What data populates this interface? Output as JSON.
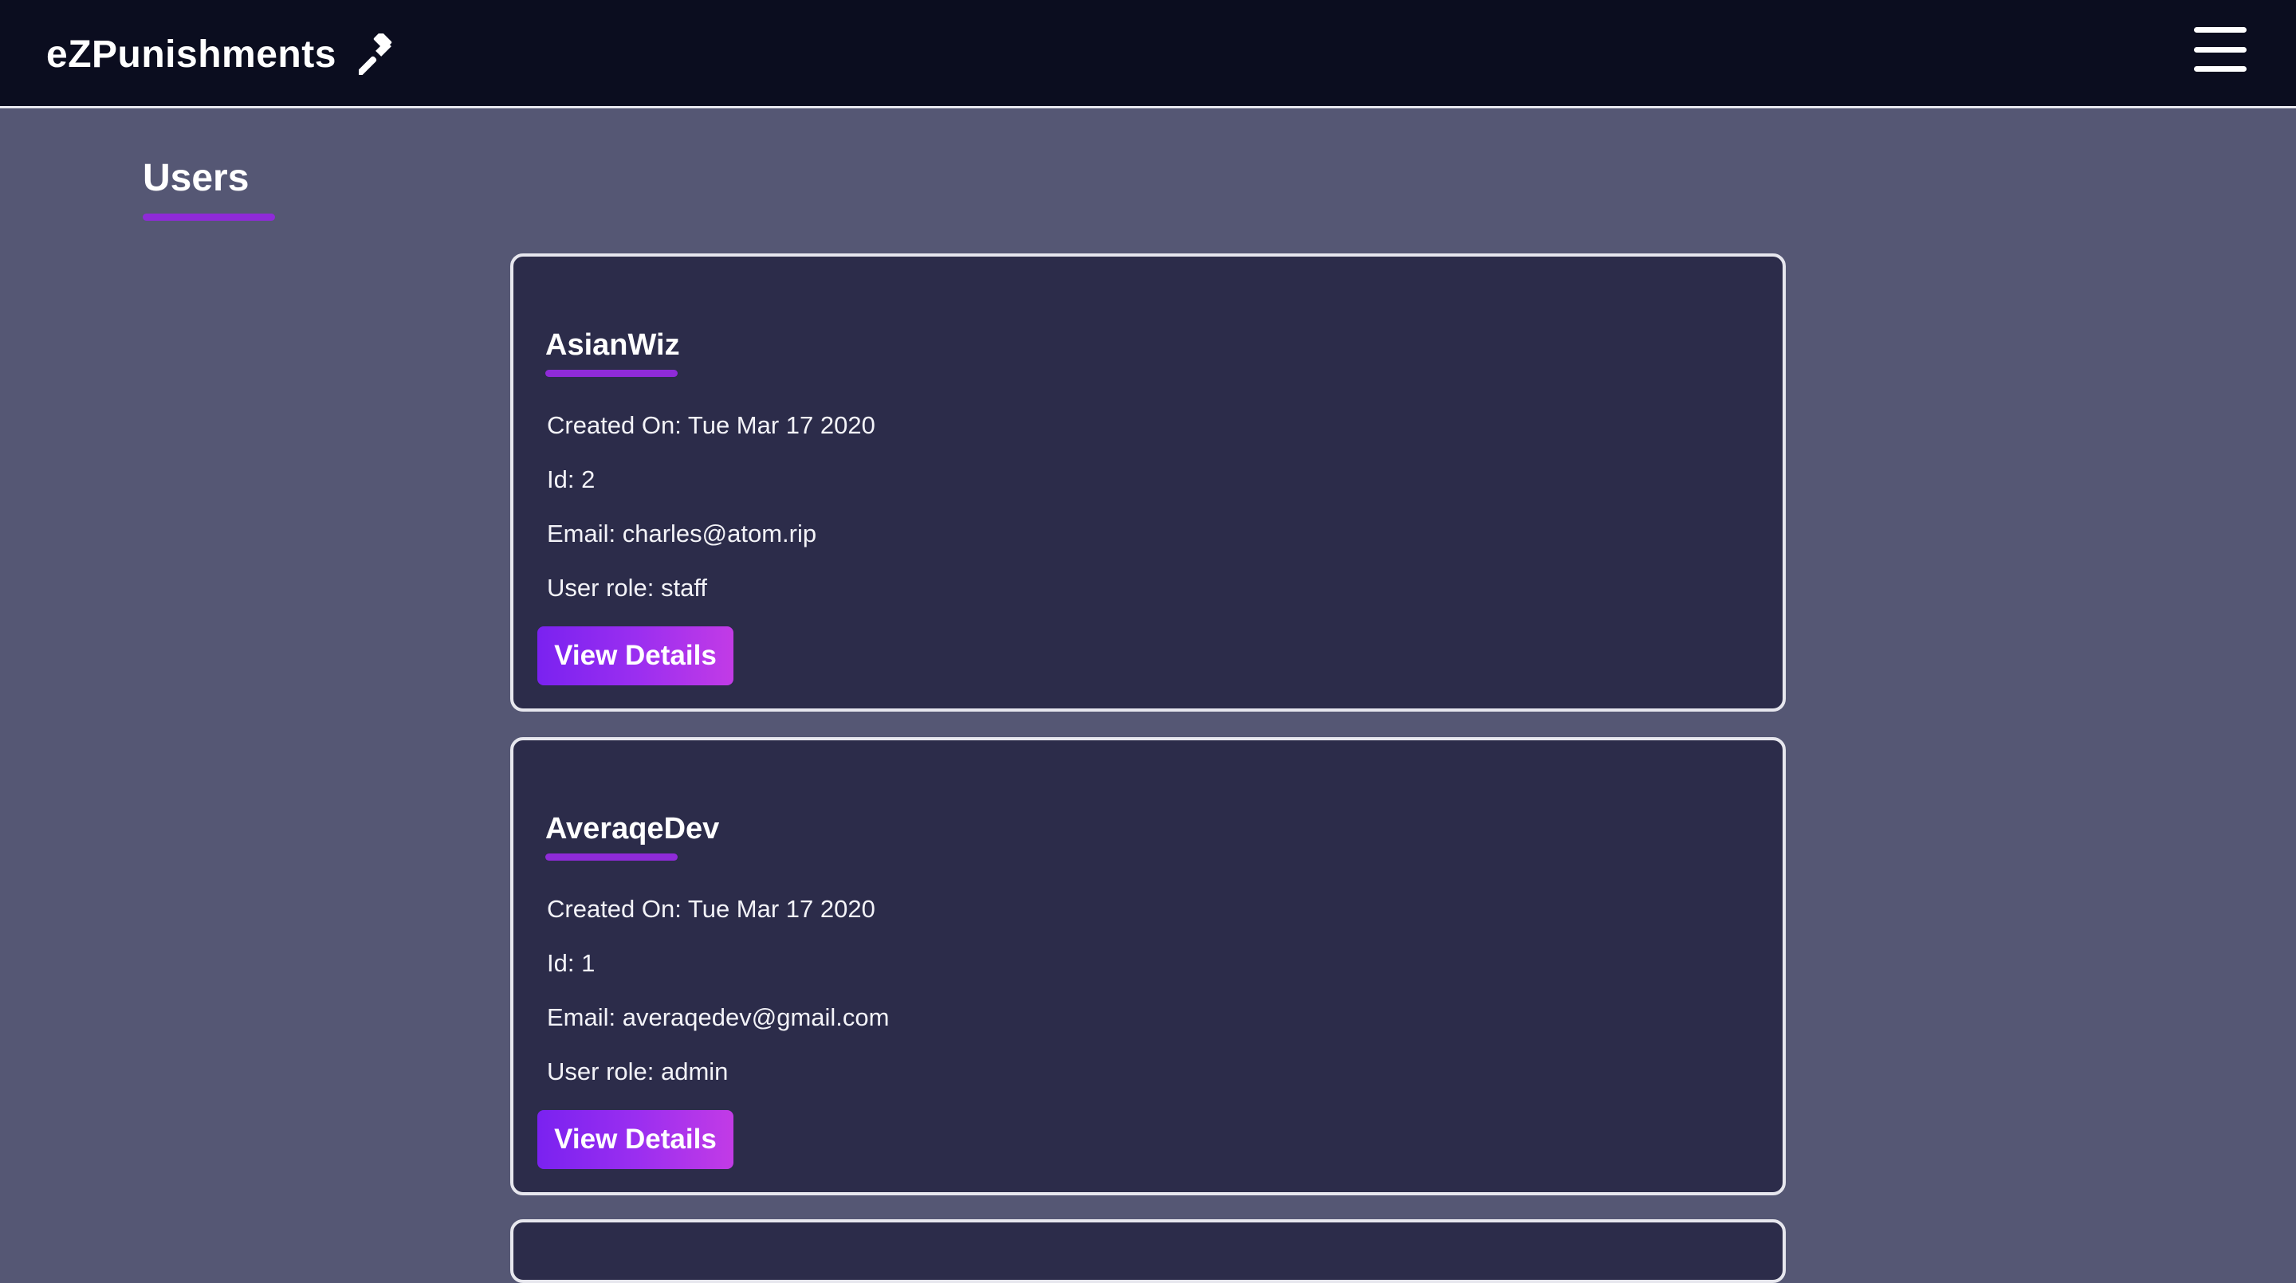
{
  "header": {
    "brand_title": "eZPunishments",
    "brand_icon": "gavel-icon",
    "menu_icon": "hamburger-menu-icon"
  },
  "main": {
    "title": "Users"
  },
  "users": [
    {
      "name": "AsianWiz",
      "created_on": "Created On: Tue Mar 17 2020",
      "id": "Id: 2",
      "email": "Email: charles@atom.rip",
      "role": "User role: staff",
      "button_label": "View Details"
    },
    {
      "name": "AveraqeDev",
      "created_on": "Created On: Tue Mar 17 2020",
      "id": "Id: 1",
      "email": "Email: averaqedev@gmail.com",
      "role": "User role: admin",
      "button_label": "View Details"
    }
  ],
  "colors": {
    "page_background": "#555774",
    "topbar_background": "#0b0d1f",
    "card_background": "#2c2c4a",
    "accent": "#8f2bd8",
    "button_gradient_start": "#7a22f0",
    "button_gradient_end": "#c23be6"
  }
}
